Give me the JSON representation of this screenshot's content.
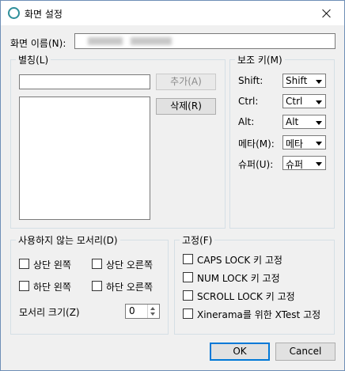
{
  "window": {
    "title": "화면 설정"
  },
  "screen_name": {
    "label": "화면 이름(N):",
    "value": ""
  },
  "alias": {
    "title": "별칭(L)",
    "input_value": "",
    "add_label": "추가(A)",
    "delete_label": "삭제(R)"
  },
  "modifiers": {
    "title": "보조 키(M)",
    "rows": [
      {
        "label": "Shift:",
        "value": "Shift"
      },
      {
        "label": "Ctrl:",
        "value": "Ctrl"
      },
      {
        "label": "Alt:",
        "value": "Alt"
      },
      {
        "label": "메타(M):",
        "value": "메타"
      },
      {
        "label": "슈퍼(U):",
        "value": "슈퍼"
      }
    ]
  },
  "corners": {
    "title": "사용하지 않는 모서리(D)",
    "top_left": "상단 왼쪽",
    "top_right": "상단 오른쪽",
    "bottom_left": "하단 왼쪽",
    "bottom_right": "하단 오른쪽",
    "size_label": "모서리 크기(Z)",
    "size_value": "0"
  },
  "fixes": {
    "title": "고정(F)",
    "items": [
      "CAPS LOCK 키 고정",
      "NUM LOCK 키 고정",
      "SCROLL LOCK 키 고정",
      "Xinerama를 위한 XTest 고정"
    ]
  },
  "buttons": {
    "ok": "OK",
    "cancel": "Cancel"
  }
}
